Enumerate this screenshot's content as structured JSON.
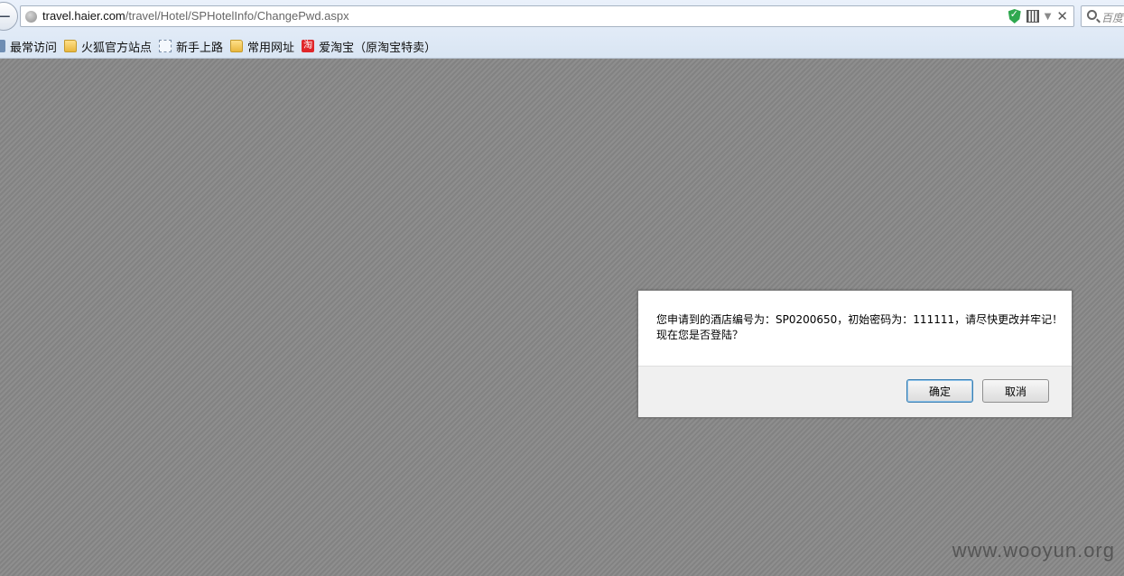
{
  "browser": {
    "url_domain": "travel.haier.com",
    "url_path": "/travel/Hotel/SPHotelInfo/ChangePwd.aspx",
    "search_placeholder": "百度",
    "bookmarks": [
      {
        "label": "最常访问",
        "icon": "most-visited-icon"
      },
      {
        "label": "火狐官方站点",
        "icon": "folder-icon"
      },
      {
        "label": "新手上路",
        "icon": "page-icon"
      },
      {
        "label": "常用网址",
        "icon": "folder-icon"
      },
      {
        "label": "爱淘宝（原淘宝特卖）",
        "icon": "taobao-icon",
        "icon_glyph": "淘"
      }
    ]
  },
  "dialog": {
    "line1": "您申请到的酒店编号为：SP0200650，初始密码为：111111，请尽快更改并牢记！",
    "line2": "现在您是否登陆？",
    "ok_label": "确定",
    "cancel_label": "取消"
  },
  "watermark": "www.wooyun.org"
}
